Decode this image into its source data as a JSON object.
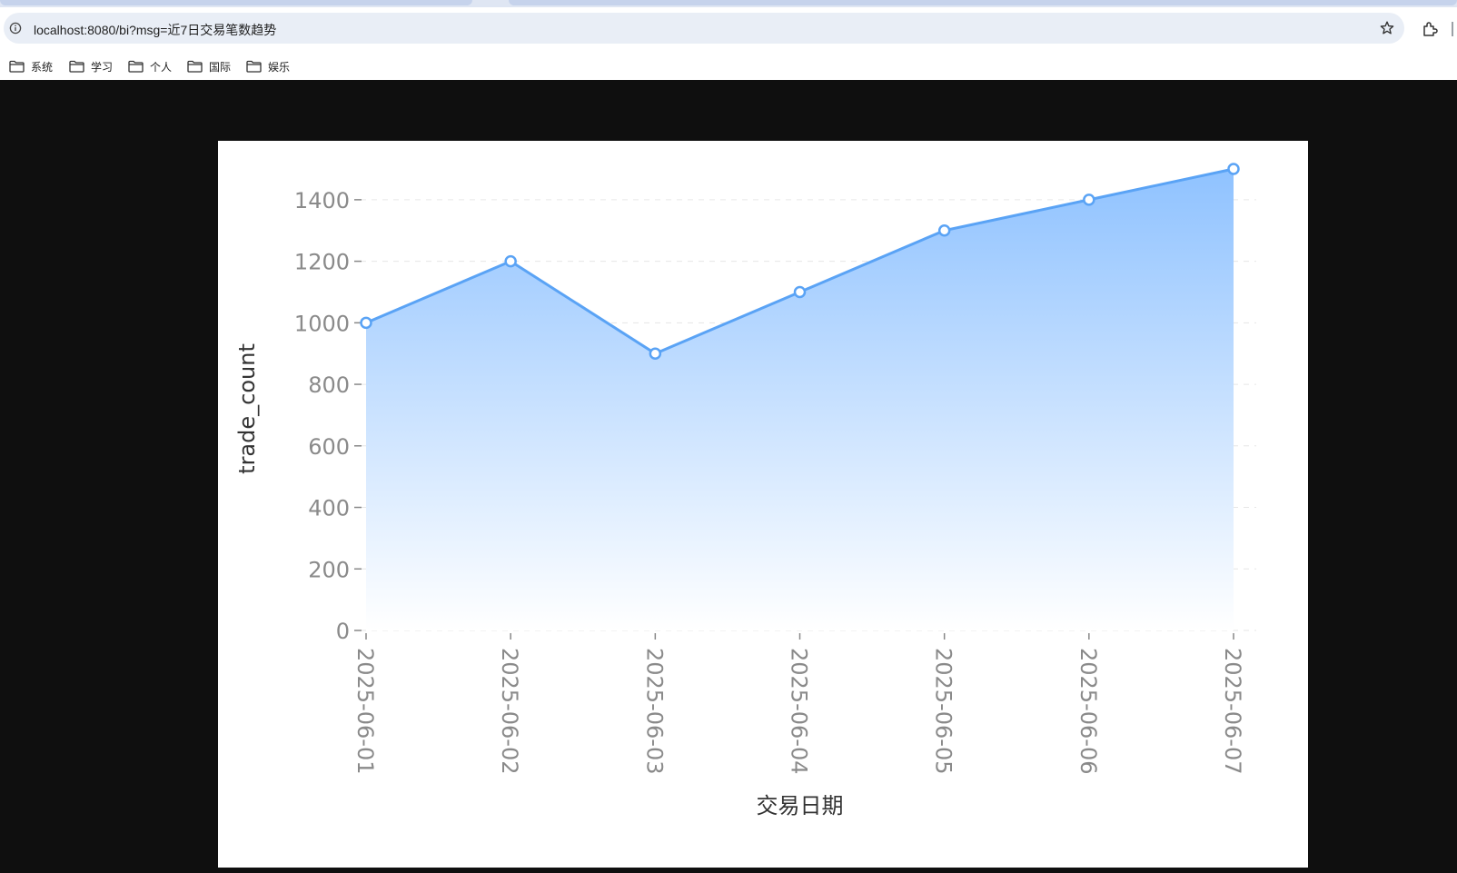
{
  "browser": {
    "url": "localhost:8080/bi?msg=近7日交易笔数趋势",
    "bookmarks": [
      {
        "label": "系统"
      },
      {
        "label": "学习"
      },
      {
        "label": "个人"
      },
      {
        "label": "国际"
      },
      {
        "label": "娱乐"
      }
    ]
  },
  "chart_data": {
    "type": "area",
    "categories": [
      "2025-06-01",
      "2025-06-02",
      "2025-06-03",
      "2025-06-04",
      "2025-06-05",
      "2025-06-06",
      "2025-06-07"
    ],
    "series": [
      {
        "values": [
          1000,
          1200,
          900,
          1100,
          1300,
          1400,
          1500
        ]
      }
    ],
    "title": "",
    "xlabel": "交易日期",
    "ylabel": "trade_count",
    "ylim": [
      0,
      1500
    ],
    "yticks": [
      0,
      200,
      400,
      600,
      800,
      1000,
      1200,
      1400
    ],
    "grid": true,
    "legend": "none",
    "colors": {
      "line": "#5aa3f5",
      "area_top": "#8fc2ff",
      "area_bottom": "#ffffff",
      "tick_text": "#8a8a8a",
      "label_text": "#333333"
    }
  }
}
